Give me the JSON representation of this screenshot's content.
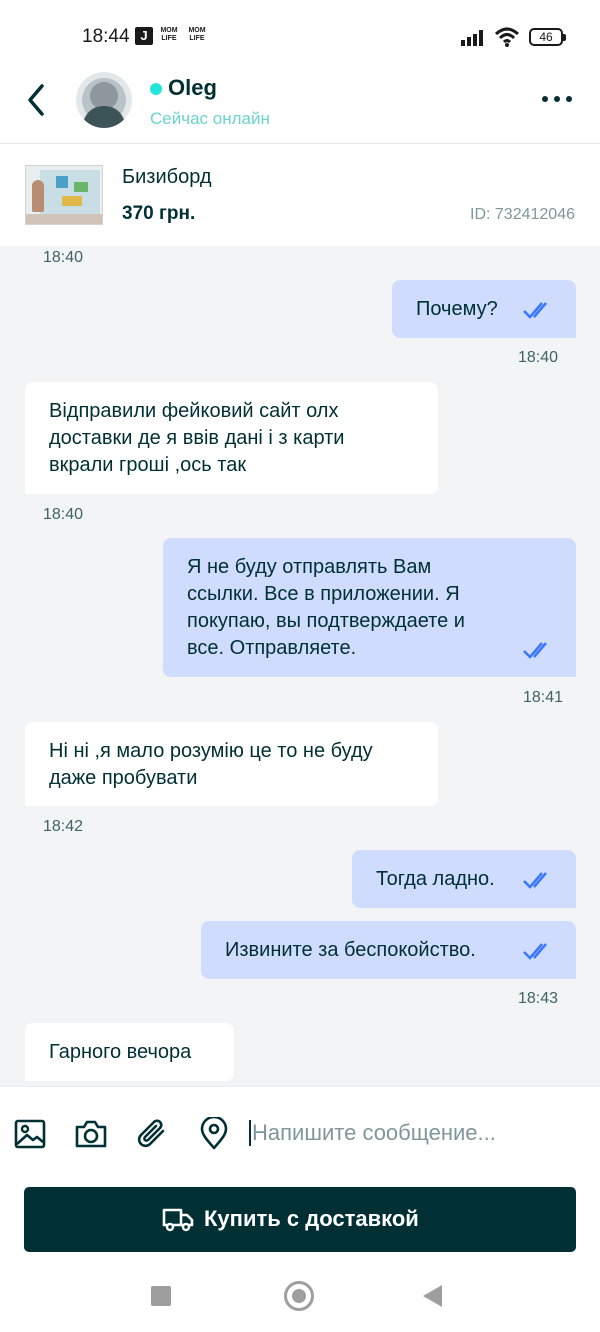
{
  "status_bar": {
    "time": "18:44",
    "badges": [
      "J",
      "MOM LIFE",
      "MOM LIFE"
    ],
    "battery": "46"
  },
  "header": {
    "contact_name": "Oleg",
    "contact_status": "Сейчас онлайн",
    "online_color": "#23e5db"
  },
  "product": {
    "title": "Бизиборд",
    "price": "370 грн.",
    "id": "ID: 732412046"
  },
  "messages": [
    {
      "dir": "in",
      "time": "18:40"
    },
    {
      "dir": "out",
      "text": "Почему?",
      "time": "18:40",
      "read": true
    },
    {
      "dir": "in",
      "lines": [
        "Відправили фейковий сайт олх",
        "доставки де я ввів дані і з карти",
        "вкрали гроші ,ось так"
      ],
      "time": "18:40"
    },
    {
      "dir": "out",
      "lines": [
        "Я не буду отправлять Вам",
        "ссылки. Все в приложении. Я",
        "покупаю, вы подтверждаете и",
        "все. Отправляете."
      ],
      "time": "18:41",
      "read": true
    },
    {
      "dir": "in",
      "lines": [
        "Ні ні ,я мало розумію це то не буду",
        "даже пробувати"
      ],
      "time": "18:42"
    },
    {
      "dir": "out",
      "text": "Тогда ладно.",
      "read": true
    },
    {
      "dir": "out",
      "text": "Извините за беспокойство.",
      "time": "18:43",
      "read": true
    },
    {
      "dir": "in",
      "text": "Гарного вечора"
    }
  ],
  "composer": {
    "placeholder": "Напишите сообщение...",
    "icons": [
      "image-icon",
      "camera-icon",
      "paperclip-icon",
      "location-pin-icon"
    ]
  },
  "buy_button": {
    "label": "Купить с доставкой",
    "icon": "truck-icon"
  },
  "colors": {
    "brand_dark": "#002f34",
    "outgoing_bubble": "#cfdcfd",
    "incoming_bubble": "#ffffff",
    "chat_background": "#f2f4f5",
    "read_ticks": "#3a77ff"
  }
}
